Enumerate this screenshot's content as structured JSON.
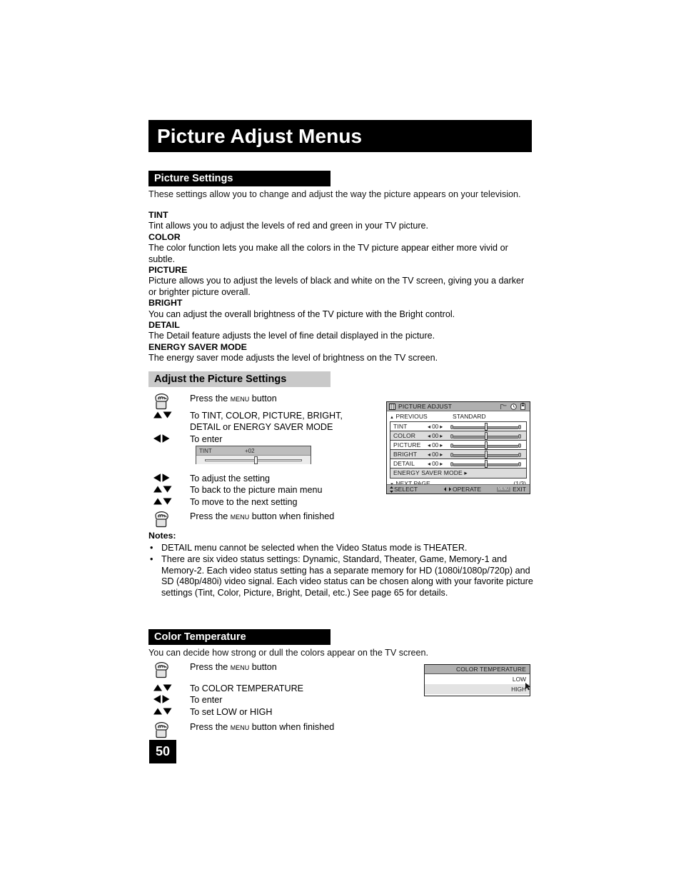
{
  "document": {
    "title": "Picture Adjust Menus",
    "page_number": "50"
  },
  "picture_settings": {
    "heading": "Picture Settings",
    "intro": "These settings allow you to change and adjust the way the picture appears on your television.",
    "definitions": [
      {
        "term": "TINT",
        "description": "Tint allows you to adjust the levels of red and green in your TV picture."
      },
      {
        "term": "COLOR",
        "description": "The color function lets you make all the colors in the TV picture appear either more vivid or subtle."
      },
      {
        "term": "PICTURE",
        "description": "Picture allows you to adjust the levels of black and white on the TV screen, giving you a darker or brighter picture overall."
      },
      {
        "term": "BRIGHT",
        "description": "You can adjust the overall brightness of the TV picture with the Bright control."
      },
      {
        "term": "DETAIL",
        "description": "The Detail feature adjusts the level of fine detail displayed in the picture."
      },
      {
        "term": "ENERGY SAVER MODE",
        "description": "The energy saver mode adjusts the level of brightness on the TV screen."
      }
    ]
  },
  "adjust_picture_settings": {
    "heading": "Adjust the Picture Settings",
    "steps_before": [
      {
        "icon": "hand-press-button-icon",
        "text_prefix": "Press the ",
        "text_menu": "Menu",
        "text_suffix": " button"
      },
      {
        "icon": "up-down-arrows-icon",
        "text": "To TINT, COLOR, PICTURE, BRIGHT,\nDETAIL or ENERGY SAVER MODE"
      },
      {
        "icon": "left-right-arrows-icon",
        "text": "To enter"
      }
    ],
    "tint_graphic": {
      "name": "TINT",
      "value": "+02"
    },
    "steps_after": [
      {
        "icon": "left-right-arrows-icon",
        "text": "To adjust the setting"
      },
      {
        "icon": "up-down-arrows-icon",
        "text": "To back to the picture main menu"
      },
      {
        "icon": "up-down-arrows-icon",
        "text": "To move to the next setting"
      },
      {
        "icon": "hand-press-button-icon",
        "text_prefix": "Press the ",
        "text_menu": "Menu",
        "text_suffix": " button when finished"
      }
    ]
  },
  "osd_picture_adjust": {
    "title": "PICTURE ADJUST",
    "title_icons": [
      "window-icon",
      "folder-icon",
      "clock-icon",
      "battery-icon"
    ],
    "previous_label": "PREVIOUS",
    "previous_arrow": "▲",
    "mode_label": "STANDARD",
    "rows": [
      {
        "name": "TINT",
        "value": "00",
        "has_slider": true
      },
      {
        "name": "COLOR",
        "value": "00",
        "has_slider": true
      },
      {
        "name": "PICTURE",
        "value": "00",
        "has_slider": true
      },
      {
        "name": "BRIGHT",
        "value": "00",
        "has_slider": true
      },
      {
        "name": "DETAIL",
        "value": "00",
        "has_slider": true
      },
      {
        "name": "ENERGY SAVER MODE ▸",
        "value": "",
        "has_slider": false
      }
    ],
    "next_page_arrow": "▼",
    "next_page_label": "NEXT PAGE",
    "page_count": "(1/3)",
    "footer": {
      "select": "SELECT",
      "operate": "OPERATE",
      "exit": "EXIT",
      "exit_chip": "MENU"
    }
  },
  "notes": {
    "title": "Notes:",
    "bullet": "•",
    "items": [
      "DETAIL menu cannot be selected when the Video Status mode is THEATER.",
      "There are six video status settings:  Dynamic, Standard, Theater, Game, Memory-1 and Memory-2.  Each video status setting has a separate memory for HD (1080i/1080p/720p) and SD (480p/480i) video signal.  Each video status can be chosen along with your favorite picture settings (Tint, Color, Picture, Bright, Detail, etc.)  See page 65 for details."
    ]
  },
  "color_temperature": {
    "heading": "Color Temperature",
    "intro": "You can decide how strong or dull the colors appear on the TV screen.",
    "steps": [
      {
        "icon": "hand-press-button-icon",
        "text_prefix": "Press the ",
        "text_menu": "Menu",
        "text_suffix": " button"
      },
      {
        "icon": "up-down-arrows-icon",
        "text": "To COLOR TEMPERATURE"
      },
      {
        "icon": "left-right-arrows-icon",
        "text": "To enter"
      },
      {
        "icon": "up-down-arrows-icon",
        "text": "To set LOW or HIGH"
      },
      {
        "icon": "hand-press-button-icon",
        "text_prefix": "Press the ",
        "text_menu": "Menu",
        "text_suffix": " button when finished"
      }
    ],
    "osd": {
      "title": "COLOR TEMPERATURE",
      "options": [
        {
          "label": "LOW",
          "selected": false
        },
        {
          "label": "HIGH",
          "selected": true
        }
      ]
    }
  },
  "colors": {
    "banner_bg": "#000000",
    "banner_fg": "#ffffff",
    "section_black_bg": "#000000",
    "section_gray_bg": "#c9c9c9",
    "osd_header_bg": "#b0b0b0",
    "osd_row_alt_bg": "#dcdcdc",
    "page_bg": "#ffffff"
  }
}
